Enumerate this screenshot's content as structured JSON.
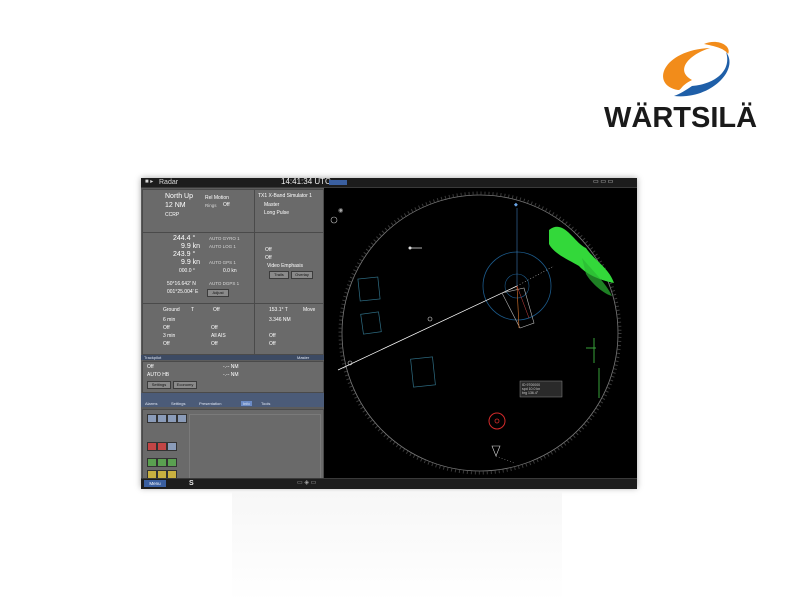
{
  "brand": {
    "name": "WÄRTSILÄ",
    "colors": {
      "orange": "#f28c1a",
      "blue": "#1f5fa8"
    }
  },
  "window": {
    "title": "Radar",
    "clock": "14:41:34 UTC"
  },
  "display": {
    "orientation": "North Up",
    "motion_label": "Rel Motion",
    "range": "12 NM",
    "rings_label": "Rings",
    "rings_value": "Off",
    "stab_value": "CCRP",
    "transceiver": "TX1 X-Band Simulator 1",
    "master_label": "Master",
    "long_pulse_label": "Long Pulse"
  },
  "nav": {
    "heading": "244.4 °",
    "heading_source": "AUTO GYRO 1",
    "speed": "9.9 kn",
    "speed_source": "AUTO LOG 1",
    "cog": "243.9 °",
    "sog": "9.9 kn",
    "sog_source": "AUTO GPS 1",
    "set_drift": "000.0 °",
    "drift_speed": "0.0 kn",
    "lat": "50°16.642' N",
    "lon": "001°25.004' E",
    "pos_source": "AUTO DGPS 1",
    "adjust_label": "Adjust"
  },
  "video": {
    "off1": "Off",
    "off2": "Off",
    "emphasis_label": "Video Emphasis",
    "trails_label": "Trails",
    "overlay_label": "Overlay"
  },
  "trails": {
    "ground": "Ground",
    "ground_mode": "T",
    "off": "Off",
    "time1": "6 min",
    "off2": "Off",
    "time2": "3 min",
    "off3": "Off",
    "time3": "Off"
  },
  "cursor": {
    "bearing": "153.1° T",
    "mode": "Move",
    "range": "3.346 NM",
    "off1": "Off",
    "off2": "Off",
    "off3": "Off",
    "all_ais": "All AIS"
  },
  "trackpilot": {
    "label": "Trackpilot",
    "master": "Master",
    "off": "Off",
    "auto": "AUTO HB",
    "dist1": "-.-- NM",
    "dist2": "-.-- NM",
    "settings": "Settings",
    "economy": "Economy"
  },
  "tabs": [
    "Alarms",
    "Settings",
    "Presentation",
    "Info",
    "Tools"
  ],
  "misc": {
    "bottom_label": "Menu",
    "s_label": "S",
    "info_box": [
      "ID 9700000",
      "spd 10.0 kn",
      "brg 136.4°"
    ]
  },
  "icons": [
    "menu-icon",
    "radar-icon",
    "target-icon",
    "vessel-icon"
  ]
}
